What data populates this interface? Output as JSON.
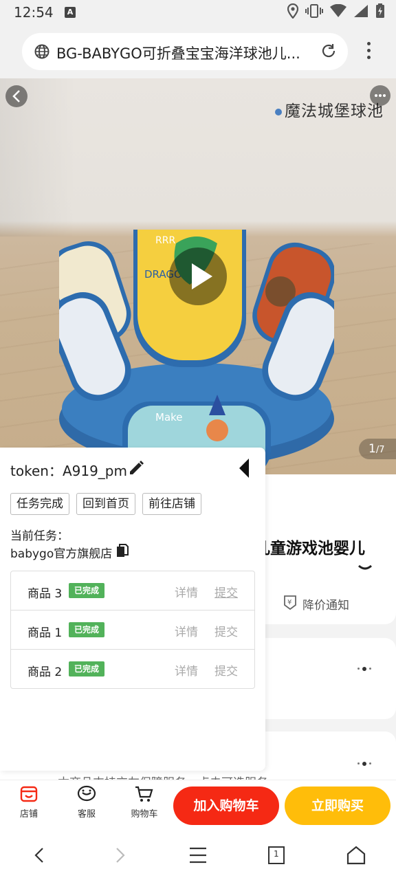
{
  "status_bar": {
    "time": "12:54",
    "notification_icon": "A"
  },
  "browser": {
    "url_title": "BG-BABYGO可折叠宝宝海洋球池儿..."
  },
  "hero": {
    "caption": "魔法城堡球池",
    "counter_current": "1",
    "counter_total": "/7"
  },
  "panel": {
    "token_prefix": "token：",
    "token_value": "A919_pm",
    "buttons": [
      "任务完成",
      "回到首页",
      "前往店铺"
    ],
    "current_task_label": "当前任务：",
    "shop_name": "babygo官方旗舰店",
    "tasks": [
      {
        "name": "商品 3",
        "status": "已完成",
        "detail": "详情",
        "submit": "提交"
      },
      {
        "name": "商品 1",
        "status": "已完成",
        "detail": "详情",
        "submit": "提交"
      },
      {
        "name": "商品 2",
        "status": "已完成",
        "detail": "详情",
        "submit": "提交"
      }
    ]
  },
  "product": {
    "title_partial": "儿童游戏池婴儿",
    "price_notice": "降价通知",
    "guarantee_partial": "本商品支持交友保障服务，点击可选服务"
  },
  "action_bar": {
    "shop": "店铺",
    "service": "客服",
    "cart": "购物车",
    "add_to_cart": "加入购物车",
    "buy_now": "立即购买"
  },
  "nav": {
    "tab_count": "1"
  },
  "colors": {
    "cart_button": "#f52914",
    "buy_button": "#ffbd0a",
    "badge_done": "#52b25a",
    "shop_icon": "#f52914"
  }
}
